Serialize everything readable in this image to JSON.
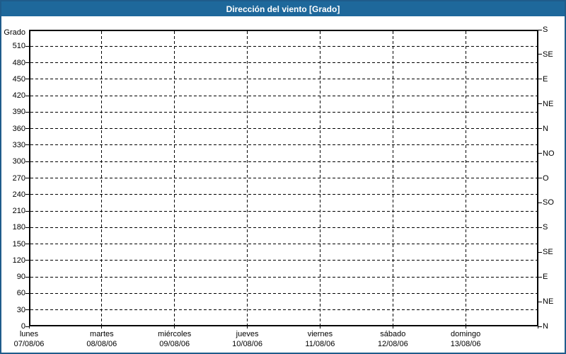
{
  "window": {
    "title": "Dirección del viento [Grado]"
  },
  "colors": {
    "titlebar": "#1e689b",
    "frame": "#1f5c8b",
    "grid": "#000000",
    "background": "#ffffff",
    "title_text": "#ffffff"
  },
  "chart_data": {
    "type": "line",
    "title": "Dirección del viento [Grado]",
    "ylabel": "Grado",
    "xlabel": "",
    "ylim": [
      0,
      540
    ],
    "ytick_step": 30,
    "yticks": [
      0,
      30,
      60,
      90,
      120,
      150,
      180,
      210,
      240,
      270,
      300,
      330,
      360,
      390,
      420,
      450,
      480,
      510
    ],
    "right_axis_ticks": [
      {
        "deg": 0,
        "label": "N"
      },
      {
        "deg": 45,
        "label": "NE"
      },
      {
        "deg": 90,
        "label": "E"
      },
      {
        "deg": 135,
        "label": "SE"
      },
      {
        "deg": 180,
        "label": "S"
      },
      {
        "deg": 225,
        "label": "SO"
      },
      {
        "deg": 270,
        "label": "O"
      },
      {
        "deg": 315,
        "label": "NO"
      },
      {
        "deg": 360,
        "label": "N"
      },
      {
        "deg": 405,
        "label": "NE"
      },
      {
        "deg": 450,
        "label": "E"
      },
      {
        "deg": 495,
        "label": "SE"
      },
      {
        "deg": 540,
        "label": "S"
      }
    ],
    "categories": [
      {
        "day": "lunes",
        "date": "07/08/06"
      },
      {
        "day": "martes",
        "date": "08/08/06"
      },
      {
        "day": "miércoles",
        "date": "09/08/06"
      },
      {
        "day": "jueves",
        "date": "10/08/06"
      },
      {
        "day": "viernes",
        "date": "11/08/06"
      },
      {
        "day": "sábado",
        "date": "12/08/06"
      },
      {
        "day": "domingo",
        "date": "13/08/06"
      }
    ],
    "series": [],
    "grid": "dashed",
    "legend": "none"
  }
}
